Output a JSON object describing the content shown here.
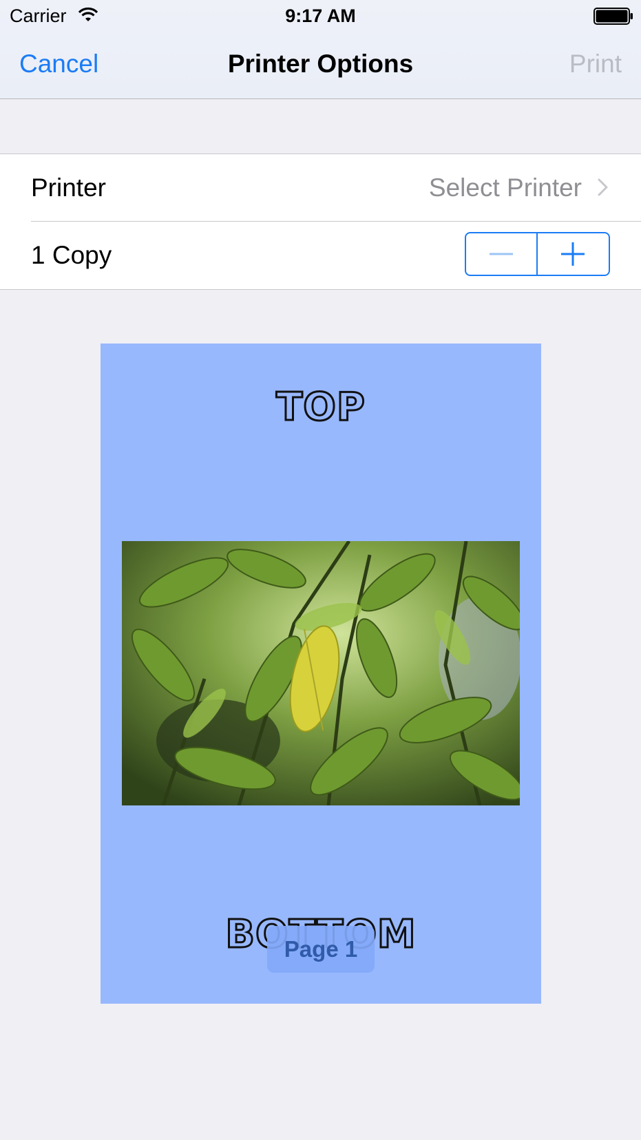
{
  "status_bar": {
    "carrier": "Carrier",
    "time": "9:17 AM",
    "icons": [
      "wifi-icon",
      "battery-icon"
    ]
  },
  "nav": {
    "cancel_label": "Cancel",
    "title": "Printer Options",
    "print_label": "Print",
    "print_enabled": false
  },
  "options": {
    "printer_label": "Printer",
    "printer_value": "Select Printer",
    "copies_label": "1 Copy",
    "copies_count": 1,
    "stepper": {
      "minus_enabled": false,
      "plus_enabled": true
    }
  },
  "preview": {
    "top_text": "TOP",
    "bottom_text": "BOTTOM",
    "page_badge": "Page 1",
    "page_color": "#98b8fd"
  },
  "colors": {
    "accent": "#1a7cf5",
    "disabled": "#b9bcc3",
    "secondary_text": "#8e8e93",
    "background": "#efeff4"
  }
}
